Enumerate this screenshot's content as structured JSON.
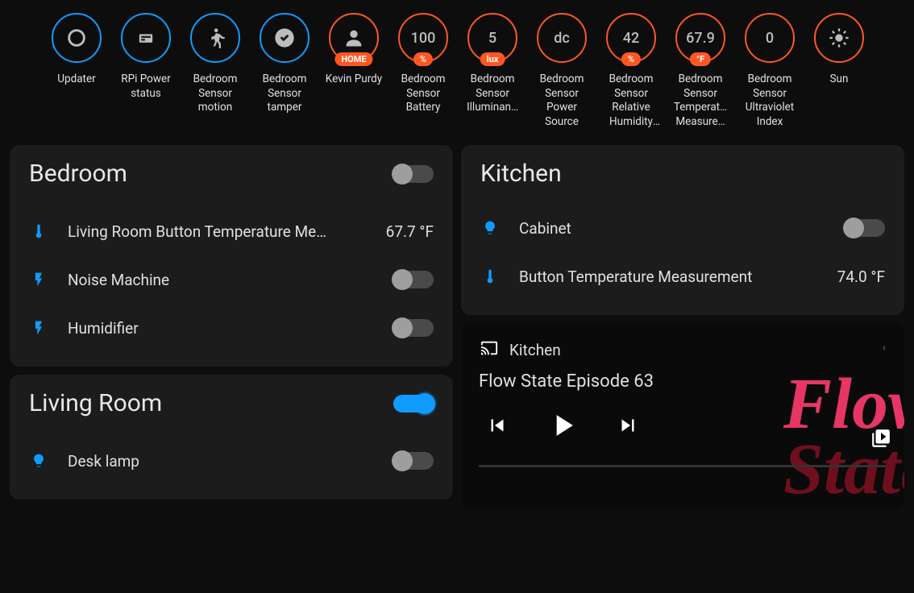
{
  "badges": [
    {
      "id": "updater",
      "label": "Updater",
      "color": "blue",
      "type": "icon-circleoutline"
    },
    {
      "id": "rpi-power",
      "label": "RPi Power status",
      "color": "blue",
      "type": "icon-raspberry"
    },
    {
      "id": "bedroom-motion",
      "label": "Bedroom Sensor motion",
      "color": "blue",
      "type": "icon-walk"
    },
    {
      "id": "bedroom-tamper",
      "label": "Bedroom Sensor tamper",
      "color": "blue",
      "type": "icon-check"
    },
    {
      "id": "kevin",
      "label": "Kevin Purdy",
      "color": "orange",
      "type": "icon-person",
      "pill": "HOME"
    },
    {
      "id": "battery",
      "label": "Bedroom Sensor Battery",
      "color": "orange",
      "type": "value",
      "value": "100",
      "pill": "%"
    },
    {
      "id": "illum",
      "label": "Bedroom Sensor Illuminan…",
      "color": "orange",
      "type": "value",
      "value": "5",
      "pill": "lux"
    },
    {
      "id": "power-src",
      "label": "Bedroom Sensor Power Source",
      "color": "orange",
      "type": "value",
      "value": "dc"
    },
    {
      "id": "humidity",
      "label": "Bedroom Sensor Relative Humidity Measure…",
      "color": "orange",
      "type": "value",
      "value": "42",
      "pill": "%"
    },
    {
      "id": "temp",
      "label": "Bedroom Sensor Temperat… Measure…",
      "color": "orange",
      "type": "value",
      "value": "67.9",
      "pill": "°F"
    },
    {
      "id": "uv",
      "label": "Bedroom Sensor Ultraviolet Index",
      "color": "orange",
      "type": "value",
      "value": "0"
    },
    {
      "id": "sun",
      "label": "Sun",
      "color": "orange",
      "type": "icon-sun"
    }
  ],
  "bedroom": {
    "title": "Bedroom",
    "toggle": false,
    "rows": [
      {
        "id": "lr-temp",
        "icon": "thermometer",
        "label": "Living Room Button Temperature Me…",
        "value": "67.7 °F"
      },
      {
        "id": "noise",
        "icon": "flash",
        "label": "Noise Machine",
        "toggle": false
      },
      {
        "id": "humidifier",
        "icon": "flash",
        "label": "Humidifier",
        "toggle": false
      }
    ]
  },
  "living_room": {
    "title": "Living Room",
    "toggle": true,
    "rows": [
      {
        "id": "desk-lamp",
        "icon": "bulb",
        "label": "Desk lamp",
        "toggle": false
      }
    ]
  },
  "kitchen": {
    "title": "Kitchen",
    "rows": [
      {
        "id": "cabinet",
        "icon": "bulb",
        "label": "Cabinet",
        "toggle": false
      },
      {
        "id": "btn-temp",
        "icon": "thermometer",
        "label": "Button Temperature Measurement",
        "value": "74.0 °F"
      }
    ]
  },
  "media": {
    "cast_target": "Kitchen",
    "title": "Flow State Episode 63",
    "art_text": "Flow\nState"
  }
}
